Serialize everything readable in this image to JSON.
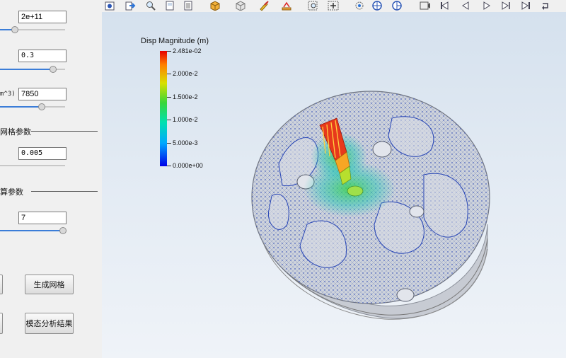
{
  "left_panel": {
    "youngs_modulus": "2e+11",
    "poisson_ratio": "0.3",
    "density_unit": "m^3)",
    "density": "7850",
    "mesh_section": "网格参数",
    "mesh_size": "0.005",
    "solve_section": "算参数",
    "mode_count": "7",
    "generate_mesh_button": "生成网格",
    "modal_result_button": "模态分析结果"
  },
  "colorbar": {
    "title": "Disp Magnitude (m)",
    "labels": [
      "2.481e-02",
      "2.000e-2",
      "1.500e-2",
      "1.000e-2",
      "5.000e-3",
      "0.000e+00"
    ],
    "max": 0.02481,
    "min": 0.0,
    "colors": [
      "#e60000",
      "#ff7f00",
      "#d9e000",
      "#39d63a",
      "#00e0b0",
      "#00a8ff",
      "#0000e8"
    ]
  },
  "toolbar": {
    "icons": [
      "camera-icon",
      "export-icon",
      "zoom-icon",
      "page-icon",
      "page-icon",
      "cube-edit-icon",
      "cube-icon",
      "pencil-icon",
      "ruler-icon",
      "zoom-box-icon",
      "fit-icon",
      "rotate-icon",
      "globe-icon",
      "globe-icon",
      "film-icon",
      "first-frame-icon",
      "prev-frame-icon",
      "play-icon",
      "next-frame-icon",
      "last-frame-icon",
      "loop-icon"
    ]
  },
  "view": {
    "background_top": "#d5e1ee",
    "background_bottom": "#eff3f8"
  }
}
